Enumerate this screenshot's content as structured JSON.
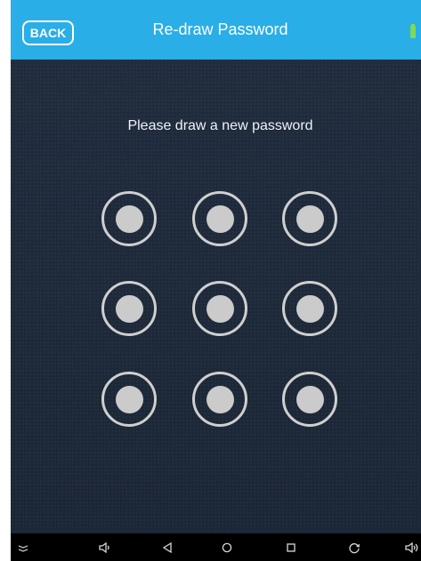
{
  "header": {
    "back_label": "BACK",
    "title": "Re-draw Password",
    "battery_icon": "battery-icon",
    "bar_color": "#29aee8"
  },
  "main": {
    "prompt": "Please draw a new password",
    "background_color": "#1c2838",
    "pattern_nodes": [
      1,
      2,
      3,
      4,
      5,
      6,
      7,
      8,
      9
    ],
    "node_color": "#cfcfcf"
  },
  "navbar": {
    "buttons": [
      "collapse-icon",
      "volume-down-icon",
      "back-triangle-icon",
      "home-circle-icon",
      "recents-square-icon",
      "rotate-icon",
      "volume-up-icon"
    ]
  }
}
